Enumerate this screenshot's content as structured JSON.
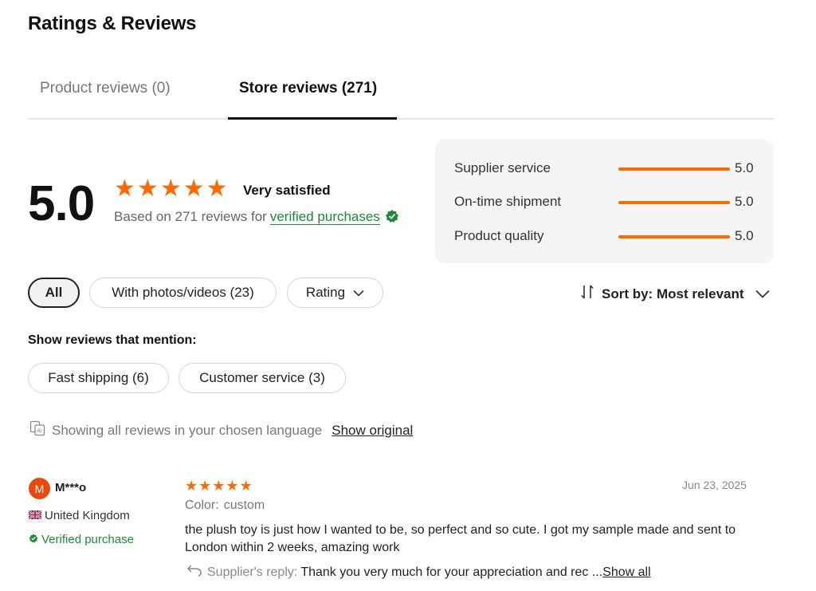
{
  "page": {
    "title": "Ratings & Reviews"
  },
  "tabs": [
    {
      "label": "Product reviews (0)"
    },
    {
      "label": "Store reviews (271)"
    }
  ],
  "summary": {
    "score": "5.0",
    "stars": 5,
    "sentiment": "Very satisfied",
    "based_on": "Based on 271 reviews for",
    "verified_link": "verified purchases"
  },
  "ratings": [
    {
      "label": "Supplier service",
      "value": "5.0",
      "level": 1.0
    },
    {
      "label": "On-time shipment",
      "value": "5.0",
      "level": 1.0
    },
    {
      "label": "Product quality",
      "value": "5.0",
      "level": 1.0
    }
  ],
  "filters": {
    "all": "All",
    "photos": "With photos/videos (23)",
    "rating": "Rating",
    "sort": "Sort by: Most relevant"
  },
  "mentions": {
    "title": "Show reviews that mention:",
    "items": [
      "Fast shipping (6)",
      "Customer service (3)"
    ]
  },
  "language": {
    "notice": "Showing all reviews in your chosen language",
    "show_original": "Show original"
  },
  "review": {
    "avatar_letter": "M",
    "name": "M***o",
    "country": "United Kingdom",
    "verified": "Verified purchase",
    "stars": 5,
    "date": "Jun 23, 2025",
    "color_label": "Color:",
    "color_value": "custom",
    "text": "the plush toy is just how I wanted to be, so perfect and so cute. I got my sample made and sent to London within 2 weeks, amazing work",
    "reply_label": "Supplier's reply:",
    "reply_text": "Thank you very much for your appreciation and rec ...",
    "show_all": "Show all"
  },
  "colors": {
    "accent": "#ff6a00",
    "verified": "#1b8a3a",
    "avatar": "#e8490f"
  },
  "icons": [
    "star-icon",
    "verified-badge-icon",
    "chevron-down-icon",
    "sort-icon",
    "translate-icon",
    "uk-flag-icon",
    "reply-icon"
  ]
}
